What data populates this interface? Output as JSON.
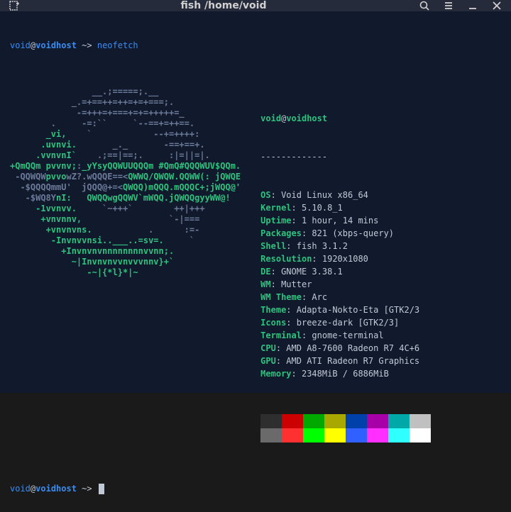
{
  "titlebar": {
    "title": "fish /home/void"
  },
  "prompt": {
    "user": "void",
    "at": "@",
    "host": "voidhost",
    "path": " ~> ",
    "cmd": "neofetch"
  },
  "ascii": {
    "lines": [
      {
        "pre": "                ",
        "g": "",
        "mid": "__.;=====;.__",
        "post": ""
      },
      {
        "pre": "            ",
        "g": "",
        "mid": "_.=+==++=++=+=+===;.",
        "post": ""
      },
      {
        "pre": "             ",
        "g": "",
        "mid": "-=+++=+===+=+=+++++=_",
        "post": ""
      },
      {
        "pre": "        ",
        "g": "",
        "mid": ".     -=:``     `--==+=++==.",
        "post": ""
      },
      {
        "pre": "       ",
        "g": "_vi,",
        "mid": "    `            --+=++++:",
        "post": ""
      },
      {
        "pre": "      ",
        "g": ".uvnvi.",
        "mid": "       _._       -==+==+.",
        "post": ""
      },
      {
        "pre": "     ",
        "g": ".vvnvnI`",
        "mid": "    .;==|==;.     :|=||=|.",
        "post": ""
      },
      {
        "pre": "",
        "g": "+QmQQm",
        "g2": "pvvnv;",
        "mid": " ",
        "g3": "_yYsyQQWUUQQQm #QmQ#",
        "mid2": ":",
        "g4": "QQQWUV$QQm.",
        "post": ""
      },
      {
        "pre": "",
        "g": "",
        "mid": " -QQWQW",
        "g2": "pvvo",
        "mid2": "wZ?.wQQQE",
        "g3": "",
        "mid3": "==<",
        "g4": "QWWQ/QWQW.QQWW(:",
        "mid4": " ",
        "g5": "jQWQE",
        "post": ""
      },
      {
        "pre": "",
        "g": "",
        "mid": "  -$QQQQmmU'  jQQQ@",
        "g2": "",
        "mid2": "+=<",
        "g3": "QWQQ)mQQQ.mQQQC+;",
        "mid3": "",
        "g4": "jWQQ@'",
        "post": ""
      },
      {
        "pre": "",
        "g": "",
        "mid": "   -$WQ8Y",
        "g2": "nI:",
        "mid2": "   ",
        "g3": "QWQQwgQQWV`mWQQ.jQWQQgyyWW@!",
        "post": ""
      },
      {
        "pre": "     ",
        "g": "-1vvnvv.",
        "mid": "     `~+++`        ++|+++",
        "post": ""
      },
      {
        "pre": "      ",
        "g": "+vnvnnv,",
        "mid": "                 `-|===",
        "post": ""
      },
      {
        "pre": "       ",
        "g": "+vnvnvns.",
        "mid": "           .      :=-",
        "post": ""
      },
      {
        "pre": "        ",
        "g": "-Invnvvnsi..___..=sv=.",
        "mid": "     `",
        "post": ""
      },
      {
        "pre": "          ",
        "g": "+Invnvnvnnnnnnnnvvnn;.",
        "mid": "",
        "post": ""
      },
      {
        "pre": "            ",
        "g": "~|Invnvnvvnvvvnnv}+`",
        "mid": "",
        "post": ""
      },
      {
        "pre": "               ",
        "g": "-~|{*l}*|~",
        "mid": "",
        "post": ""
      }
    ]
  },
  "info": {
    "user": "void",
    "host": "voidhost",
    "dash": "-------------",
    "rows": [
      {
        "k": "OS",
        "v": "Void Linux x86_64"
      },
      {
        "k": "Kernel",
        "v": "5.10.8_1"
      },
      {
        "k": "Uptime",
        "v": "1 hour, 14 mins"
      },
      {
        "k": "Packages",
        "v": "821 (xbps-query)"
      },
      {
        "k": "Shell",
        "v": "fish 3.1.2"
      },
      {
        "k": "Resolution",
        "v": "1920x1080"
      },
      {
        "k": "DE",
        "v": "GNOME 3.38.1"
      },
      {
        "k": "WM",
        "v": "Mutter"
      },
      {
        "k": "WM Theme",
        "v": "Arc"
      },
      {
        "k": "Theme",
        "v": "Adapta-Nokto-Eta [GTK2/3"
      },
      {
        "k": "Icons",
        "v": "breeze-dark [GTK2/3]"
      },
      {
        "k": "Terminal",
        "v": "gnome-terminal"
      },
      {
        "k": "CPU",
        "v": "AMD A8-7600 Radeon R7 4C+6"
      },
      {
        "k": "GPU",
        "v": "AMD ATI Radeon R7 Graphics"
      },
      {
        "k": "Memory",
        "v": "2348MiB / 6886MiB"
      }
    ]
  },
  "colors": {
    "row1": [
      "#2e2e2e",
      "#cc0000",
      "#00a800",
      "#a8a800",
      "#0040aa",
      "#a800a8",
      "#00a8a8",
      "#c0c0c0"
    ],
    "row2": [
      "#6a6a6a",
      "#ff3030",
      "#00ff00",
      "#ffff00",
      "#3060ff",
      "#ff30ff",
      "#30ffff",
      "#ffffff"
    ]
  }
}
